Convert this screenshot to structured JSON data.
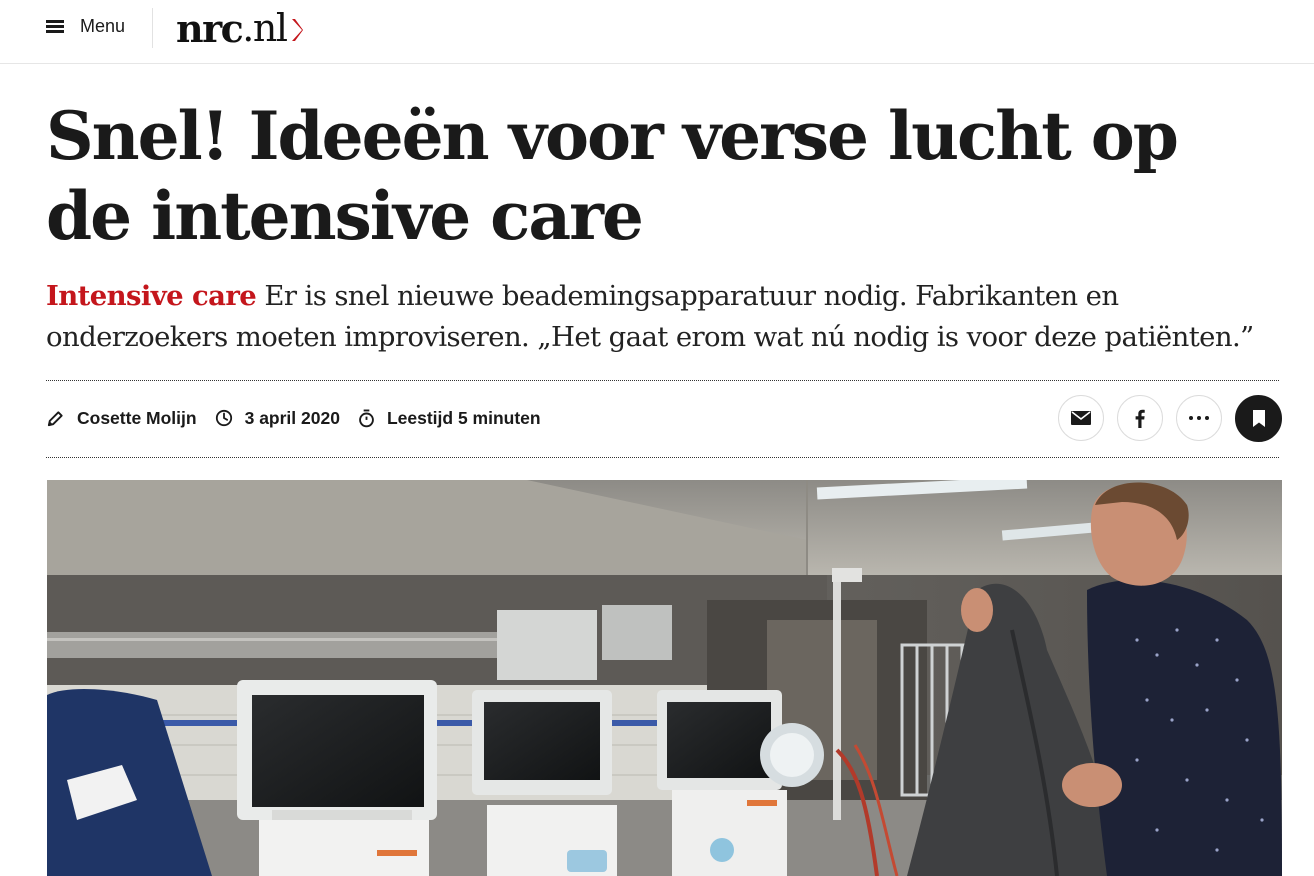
{
  "header": {
    "menu_label": "Menu",
    "logo_bold": "nrc",
    "logo_thin": ".nl",
    "accent_color": "#c4161c"
  },
  "article": {
    "headline": "Snel! Ideeën voor verse lucht op de intensive care",
    "kicker": "Intensive care",
    "intro": "Er is snel nieuwe beademingsapparatuur nodig. Fabrikanten en onderzoekers moeten improviseren. „Het gaat erom wat nú nodig is voor deze patiënten.”",
    "author": "Cosette Molijn",
    "date": "3 april 2020",
    "reading_time": "Leestijd 5 minuten"
  },
  "icons": {
    "author": "pencil-icon",
    "date": "clock-icon",
    "reading_time": "stopwatch-icon",
    "share_email": "mail-icon",
    "share_facebook": "facebook-icon",
    "more": "more-icon",
    "bookmark": "bookmark-icon"
  }
}
